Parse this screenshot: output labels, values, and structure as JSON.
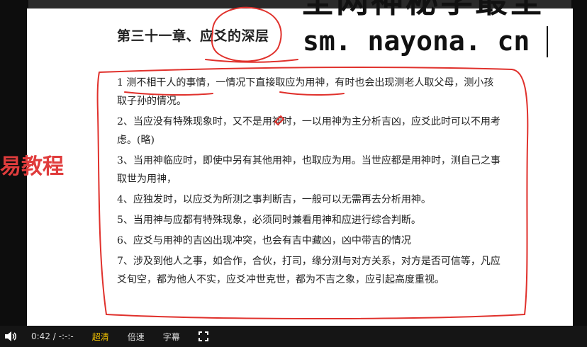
{
  "document": {
    "chapter_title": "第三十一章、应爻的深层",
    "items": [
      "1 测不相干人的事情，一情况下直接取应为用神，有时也会出现测老人取父母，测小孩取子孙的情况。",
      "2、当应没有特殊现象时，又不是用神时，一以用神为主分析吉凶，应爻此时可以不用考虑。(略)",
      "3、当用神临应时，即使中另有其他用神，也取应为用。当世应都是用神时，测自己之事取世为用神，",
      "4、应独发时，以应爻为所测之事判断吉，一般可以无需再去分析用神。",
      "5、当用神与应都有特殊现象，必须同时兼看用神和应进行综合判断。",
      "6、应爻与用神的吉凶出现冲突，也会有吉中藏凶，凶中带吉的情况",
      "7、涉及到他人之事，如合作，合伙，打司，缘分测与对方关系，对方是否可信等，凡应爻旬空，都为他人不实，应爻冲世克世，都为不吉之象，应引起高度重视。"
    ]
  },
  "watermark": {
    "top_text": "全网神秘学最全",
    "url": "sm. nayona. cn",
    "side_text": "易教程"
  },
  "player": {
    "time": "0:42 / -:-:-",
    "quality_label": "超清",
    "speed_label": "倍速",
    "subtitle_label": "字幕"
  },
  "colors": {
    "annotation": "#e0312c",
    "accent": "#f5c400",
    "player_bg": "#151515"
  }
}
